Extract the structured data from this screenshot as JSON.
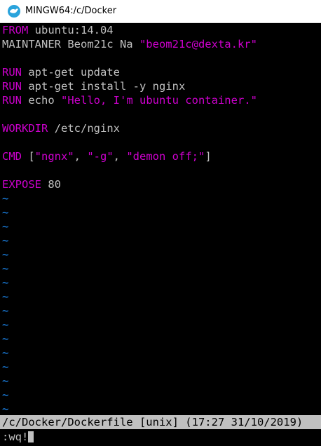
{
  "window": {
    "title": "MINGW64:/c/Docker",
    "icon": "mingw-terminal-icon",
    "title_bar_color": "#ffffff",
    "background": "#000000",
    "keyword_color": "#cd00cd",
    "tilde_color": "#1e90ff"
  },
  "editor": {
    "lines": {
      "from_kw": "FROM",
      "from_rest": " ubuntu:14.04",
      "maintainer_kw": "MAINTANER Beom21c Na ",
      "maintainer_email": "\"beom21c@dexta.kr\"",
      "run1_kw": "RUN",
      "run1_rest": " apt-get update",
      "run2_kw": "RUN",
      "run2_rest": " apt-get install -y nginx",
      "run3_kw": "RUN",
      "run3_rest": " echo ",
      "run3_str": "\"Hello, I'm ubuntu container.\"",
      "workdir_kw": "WORKDIR",
      "workdir_rest": " /etc/nginx",
      "cmd_kw": "CMD",
      "cmd_open": " [",
      "cmd_arg1": "\"ngnx\"",
      "cmd_sep1": ", ",
      "cmd_arg2": "\"-g\"",
      "cmd_sep2": ", ",
      "cmd_arg3": "\"demon off;\"",
      "cmd_close": "]",
      "expose_kw": "EXPOSE",
      "expose_rest": " 80"
    },
    "empty_marker": "~",
    "empty_line_count": 16
  },
  "statusline": {
    "text": "/c/Docker/Dockerfile [unix] (17:27 31/10/2019)"
  },
  "command": {
    "text": ":wq!"
  }
}
